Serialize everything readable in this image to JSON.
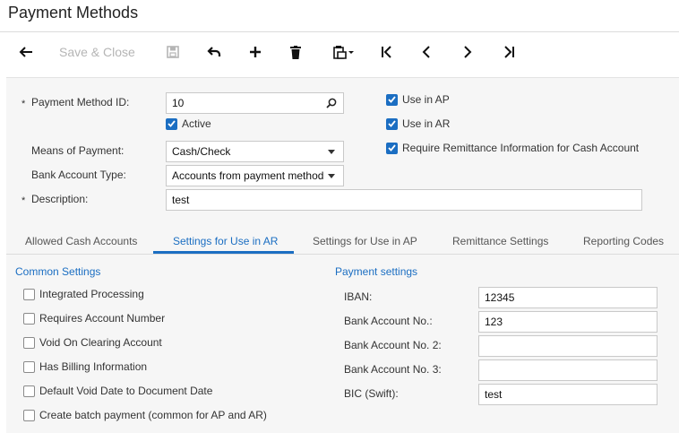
{
  "page": {
    "title": "Payment Methods"
  },
  "toolbar": {
    "save_close_label": "Save & Close"
  },
  "form": {
    "payment_method_id": {
      "label": "Payment Method ID:",
      "value": "10",
      "required_mark": "*"
    },
    "active": {
      "label": "Active",
      "checked": true
    },
    "means_of_payment": {
      "label": "Means of Payment:",
      "value": "Cash/Check"
    },
    "bank_account_type": {
      "label": "Bank Account Type:",
      "value": "Accounts from payment method"
    },
    "description": {
      "label": "Description:",
      "value": "test",
      "required_mark": "*"
    },
    "use_in_ap": {
      "label": "Use in AP",
      "checked": true
    },
    "use_in_ar": {
      "label": "Use in AR",
      "checked": true
    },
    "require_remittance": {
      "label": "Require Remittance Information for Cash Account",
      "checked": true
    }
  },
  "tabs": [
    {
      "label": "Allowed Cash Accounts",
      "active": false
    },
    {
      "label": "Settings for Use in AR",
      "active": true
    },
    {
      "label": "Settings for Use in AP",
      "active": false
    },
    {
      "label": "Remittance Settings",
      "active": false
    },
    {
      "label": "Reporting Codes",
      "active": false
    }
  ],
  "common_settings": {
    "heading": "Common Settings",
    "items": [
      {
        "label": "Integrated Processing",
        "checked": false
      },
      {
        "label": "Requires Account Number",
        "checked": false
      },
      {
        "label": "Void On Clearing Account",
        "checked": false
      },
      {
        "label": "Has Billing Information",
        "checked": false
      },
      {
        "label": "Default Void Date to Document Date",
        "checked": false
      },
      {
        "label": "Create batch payment (common for AP and AR)",
        "checked": false
      }
    ]
  },
  "payment_settings": {
    "heading": "Payment settings",
    "fields": [
      {
        "label": "IBAN:",
        "value": "12345"
      },
      {
        "label": "Bank Account No.:",
        "value": "123"
      },
      {
        "label": "Bank Account No. 2:",
        "value": ""
      },
      {
        "label": "Bank Account No. 3:",
        "value": ""
      },
      {
        "label": "BIC (Swift):",
        "value": "test"
      }
    ]
  },
  "colors": {
    "accent": "#1b6ec2",
    "panel_bg": "#f6f6f6",
    "disabled_text": "#b5b5b5"
  },
  "icons": [
    "back-icon",
    "save-icon",
    "undo-icon",
    "add-icon",
    "delete-icon",
    "copy-paste-icon",
    "first-record-icon",
    "previous-record-icon",
    "next-record-icon",
    "last-record-icon",
    "search-icon",
    "dropdown-icon",
    "checkmark-icon"
  ]
}
